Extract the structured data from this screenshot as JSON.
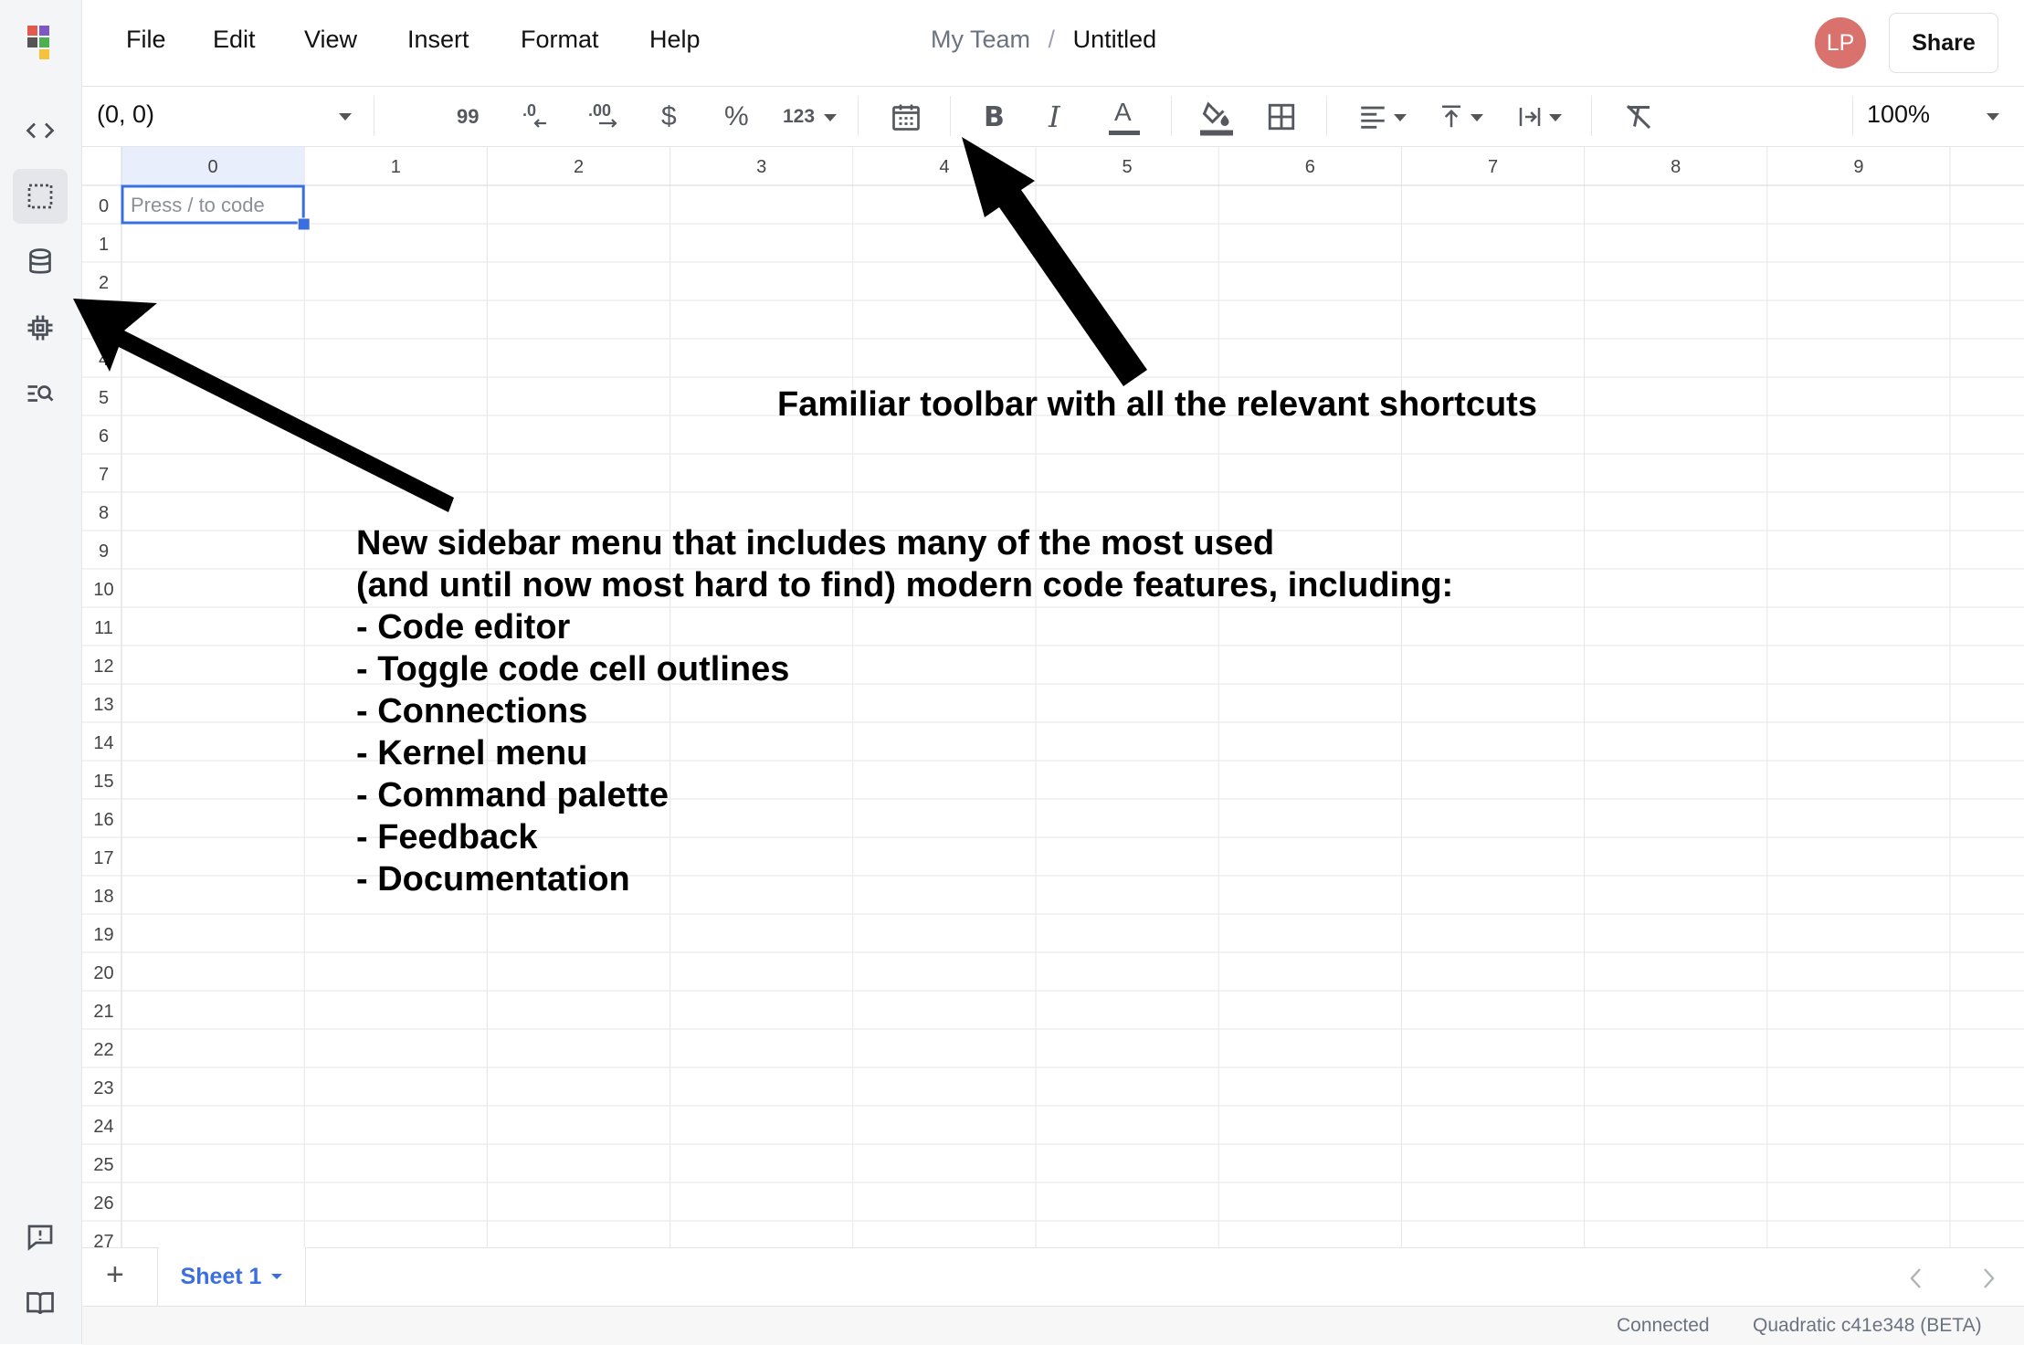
{
  "menu": {
    "file": "File",
    "edit": "Edit",
    "view": "View",
    "insert": "Insert",
    "format": "Format",
    "help": "Help"
  },
  "breadcrumb": {
    "team": "My Team",
    "separator": "/",
    "file": "Untitled"
  },
  "user": {
    "initials": "LP"
  },
  "share_label": "Share",
  "toolbar": {
    "cell_ref": "(0, 0)",
    "format_quote": "99",
    "format_currency": "$",
    "format_percent": "%",
    "format_number": "123",
    "bold": "B",
    "italic": "I",
    "text_color": "A",
    "zoom": "100%"
  },
  "grid": {
    "columns": [
      "0",
      "1",
      "2",
      "3",
      "4",
      "5",
      "6",
      "7",
      "8",
      "9"
    ],
    "rows": [
      "0",
      "1",
      "2",
      "3",
      "4",
      "5",
      "6",
      "7",
      "8",
      "9",
      "10",
      "11",
      "12",
      "13",
      "14",
      "15",
      "16",
      "17",
      "18",
      "19",
      "20",
      "21",
      "22",
      "23",
      "24",
      "25",
      "26",
      "27"
    ],
    "cell_placeholder": "Press / to code"
  },
  "annotations": {
    "toolbar_note": "Familiar toolbar with all the relevant shortcuts",
    "sidebar_note": [
      "New sidebar menu that includes many of the most used",
      "(and until now most hard to find) modern code features, including:",
      "- Code editor",
      "- Toggle code cell outlines",
      "- Connections",
      "- Kernel menu",
      "- Command palette",
      "- Feedback",
      "- Documentation"
    ]
  },
  "sheets": {
    "add": "+",
    "active": "Sheet 1"
  },
  "status": {
    "connection": "Connected",
    "version": "Quadratic c41e348 (BETA)"
  },
  "colors": {
    "accent": "#3b6fe0",
    "avatar": "#d9726d",
    "sidebar_bg": "#f4f5f7"
  }
}
